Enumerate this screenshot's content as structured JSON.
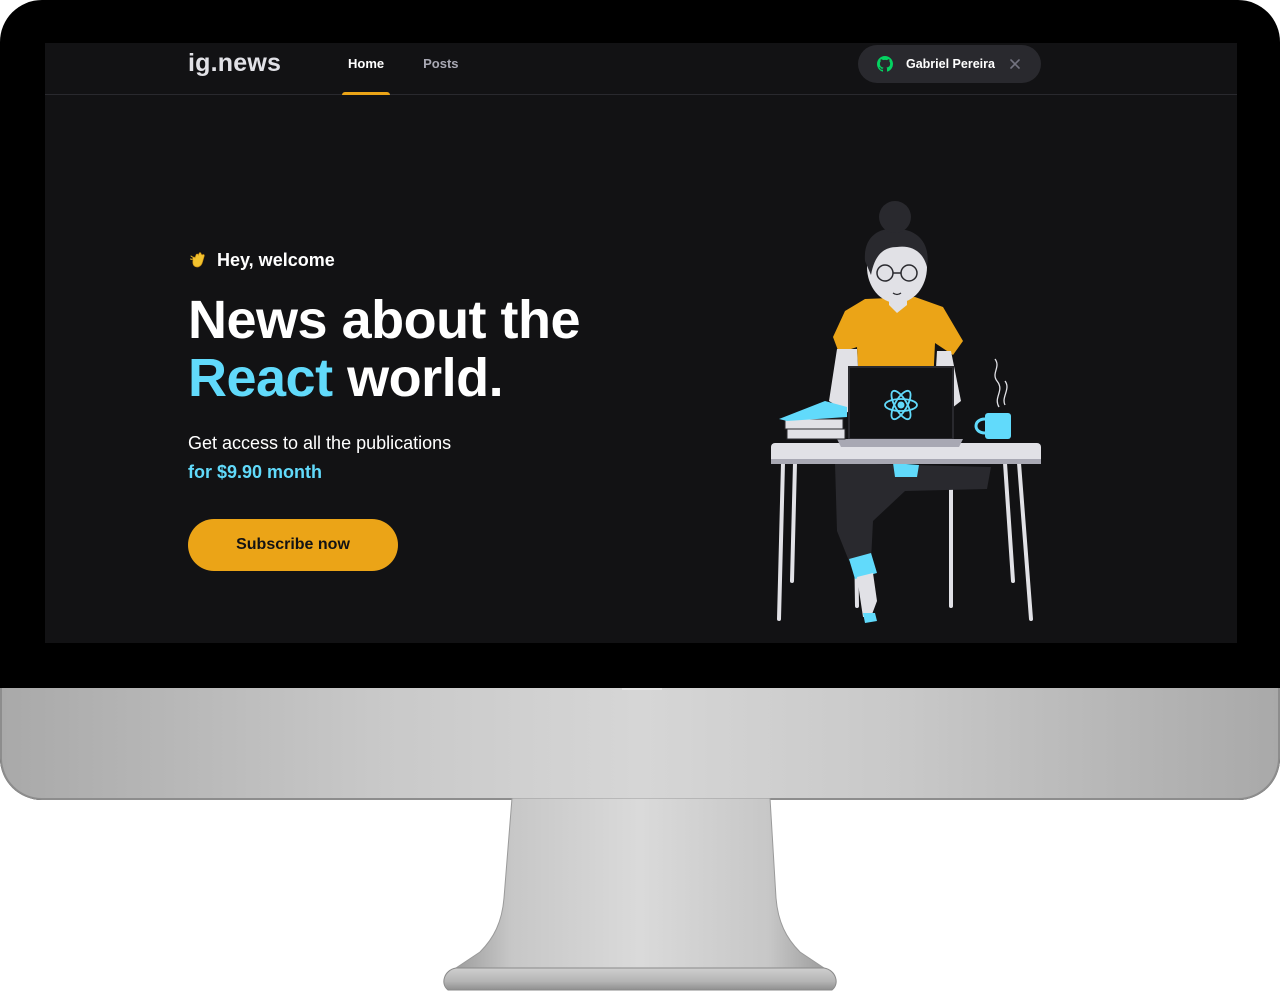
{
  "app": {
    "logo": "ig.news",
    "accent_color": "#eba417",
    "react_color": "#61dafb",
    "background_color": "#121214"
  },
  "nav": {
    "items": [
      {
        "label": "Home",
        "active": true
      },
      {
        "label": "Posts",
        "active": false
      }
    ]
  },
  "user": {
    "name": "Gabriel Pereira",
    "provider_icon": "github-icon",
    "signout_icon": "close-icon"
  },
  "hero": {
    "greeting_icon": "waving-hand-icon",
    "greeting": "Hey, welcome",
    "headline_line1": "News about the",
    "headline_accent": "React",
    "headline_rest": " world.",
    "subtitle": "Get access to all the publications",
    "price": "for $9.90 month",
    "cta": "Subscribe now",
    "illustration": "woman-at-laptop-illustration"
  }
}
